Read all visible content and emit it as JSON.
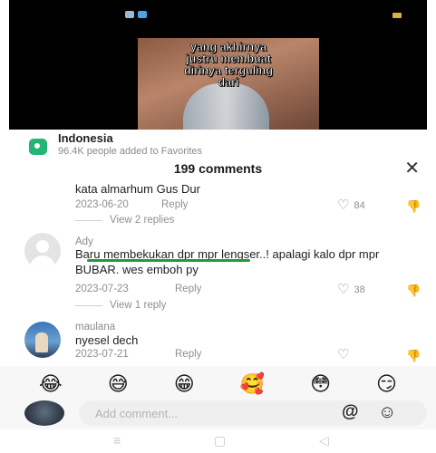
{
  "video": {
    "caption_lines": [
      "yang akhirnya",
      "justru membuat",
      "dirinya terguling",
      "dari"
    ]
  },
  "sound": {
    "icon": "location-pin-icon",
    "title": "Indonesia",
    "subtitle": "96.4K people added to Favorites"
  },
  "comments_header": {
    "title": "199 comments",
    "close_icon": "✕"
  },
  "comments": [
    {
      "text": "kata almarhum Gus Dur",
      "date": "2023-06-20",
      "reply_label": "Reply",
      "likes": "84",
      "view_replies": "View 2 replies"
    },
    {
      "author": "Ady",
      "text": "Baru membekukan dpr mpr lengser..! apalagi kalo dpr mpr BUBAR. wes emboh py",
      "date": "2023-07-23",
      "reply_label": "Reply",
      "likes": "38",
      "view_replies": "View 1 reply"
    },
    {
      "author": "maulana",
      "text": "nyesel dech",
      "date": "2023-07-21",
      "reply_label": "Reply",
      "likes": ""
    }
  ],
  "emoji_bar": [
    "😂",
    "😅",
    "😁",
    "🥰",
    "😳",
    "😏"
  ],
  "composer": {
    "placeholder": "Add comment...",
    "mention_symbol": "@",
    "emoji_symbol": "☺"
  },
  "navbar": {
    "menu_symbol": "≡",
    "home_symbol": "▢",
    "back_symbol": "◁"
  },
  "colors": {
    "sound_icon": "#22b573",
    "highlight_underline": "#1e9b3a"
  }
}
